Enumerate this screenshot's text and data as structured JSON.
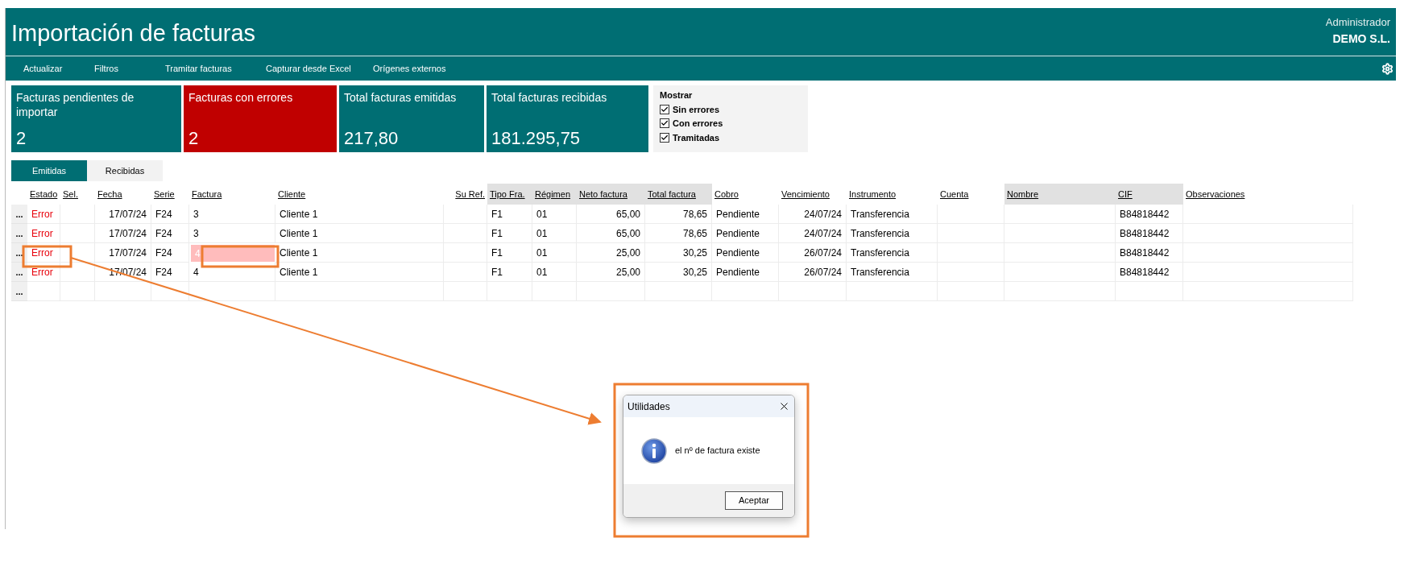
{
  "app": {
    "title": "Importación de facturas",
    "user": "Administrador",
    "company": "DEMO S.L."
  },
  "toolbar": [
    "Actualizar",
    "Filtros",
    "Tramitar facturas",
    "Capturar desde Excel",
    "Orígenes externos"
  ],
  "cards": [
    {
      "label": "Facturas pendientes de importar",
      "value": "2",
      "kind": "normal"
    },
    {
      "label": "Facturas con errores",
      "value": "2",
      "kind": "alert"
    },
    {
      "label": "Total facturas emitidas",
      "value": "217,80",
      "kind": "normal"
    },
    {
      "label": "Total facturas recibidas",
      "value": "181.295,75",
      "kind": "normal"
    }
  ],
  "filters": {
    "title": "Mostrar",
    "options": [
      {
        "label": "Sin errores",
        "checked": true
      },
      {
        "label": "Con errores",
        "checked": true
      },
      {
        "label": "Tramitadas",
        "checked": true
      }
    ]
  },
  "tabs": [
    {
      "label": "Emitidas",
      "selected": true
    },
    {
      "label": "Recibidas",
      "selected": false
    }
  ],
  "table": {
    "columns": [
      {
        "label": "Estado",
        "kind": "status",
        "shaded": false
      },
      {
        "label": "Sel.",
        "kind": "text",
        "shaded": false
      },
      {
        "label": "Fecha",
        "kind": "date",
        "shaded": false
      },
      {
        "label": "Serie",
        "kind": "text",
        "shaded": false
      },
      {
        "label": "Factura",
        "kind": "text",
        "shaded": false
      },
      {
        "label": "Cliente",
        "kind": "text",
        "shaded": false
      },
      {
        "label": "Su Ref.",
        "kind": "number",
        "shaded": false
      },
      {
        "label": "Tipo Fra.",
        "kind": "text",
        "shaded": true
      },
      {
        "label": "Régimen",
        "kind": "text",
        "shaded": true
      },
      {
        "label": "Neto factura",
        "kind": "number",
        "shaded": true
      },
      {
        "label": "Total factura",
        "kind": "number",
        "shaded": true
      },
      {
        "label": "Cobro",
        "kind": "text",
        "shaded": false
      },
      {
        "label": "Vencimiento",
        "kind": "date",
        "shaded": false
      },
      {
        "label": "Instrumento",
        "kind": "text",
        "shaded": false
      },
      {
        "label": "Cuenta",
        "kind": "text",
        "shaded": false
      },
      {
        "label": "Nombre",
        "kind": "text",
        "shaded": true
      },
      {
        "label": "CIF",
        "kind": "text",
        "shaded": true
      },
      {
        "label": "Observaciones",
        "kind": "text",
        "shaded": false
      }
    ],
    "rows": [
      {
        "button": "...",
        "factura_invalid": false,
        "cells": [
          "Error",
          null,
          "17/07/24",
          "F24",
          "3",
          "Cliente 1",
          null,
          "F1",
          "01",
          "65,00",
          "78,65",
          "Pendiente",
          "24/07/24",
          "Transferencia",
          null,
          null,
          "B84818442",
          null
        ]
      },
      {
        "button": "...",
        "factura_invalid": false,
        "cells": [
          "Error",
          null,
          "17/07/24",
          "F24",
          "3",
          "Cliente 1",
          null,
          "F1",
          "01",
          "65,00",
          "78,65",
          "Pendiente",
          "24/07/24",
          "Transferencia",
          null,
          null,
          "B84818442",
          null
        ]
      },
      {
        "button": "...",
        "factura_invalid": true,
        "cells": [
          "Error",
          null,
          "17/07/24",
          "F24",
          "4",
          "Cliente 1",
          null,
          "F1",
          "01",
          "25,00",
          "30,25",
          "Pendiente",
          "26/07/24",
          "Transferencia",
          null,
          null,
          "B84818442",
          null
        ]
      },
      {
        "button": "...",
        "factura_invalid": false,
        "cells": [
          "Error",
          null,
          "17/07/24",
          "F24",
          "4",
          "Cliente 1",
          null,
          "F1",
          "01",
          "25,00",
          "30,25",
          "Pendiente",
          "26/07/24",
          "Transferencia",
          null,
          null,
          "B84818442",
          null
        ]
      },
      {
        "button": "...",
        "factura_invalid": false,
        "cells": []
      }
    ]
  },
  "dialog": {
    "title": "Utilidades",
    "message": "el nº de factura existe",
    "button": "Aceptar"
  }
}
